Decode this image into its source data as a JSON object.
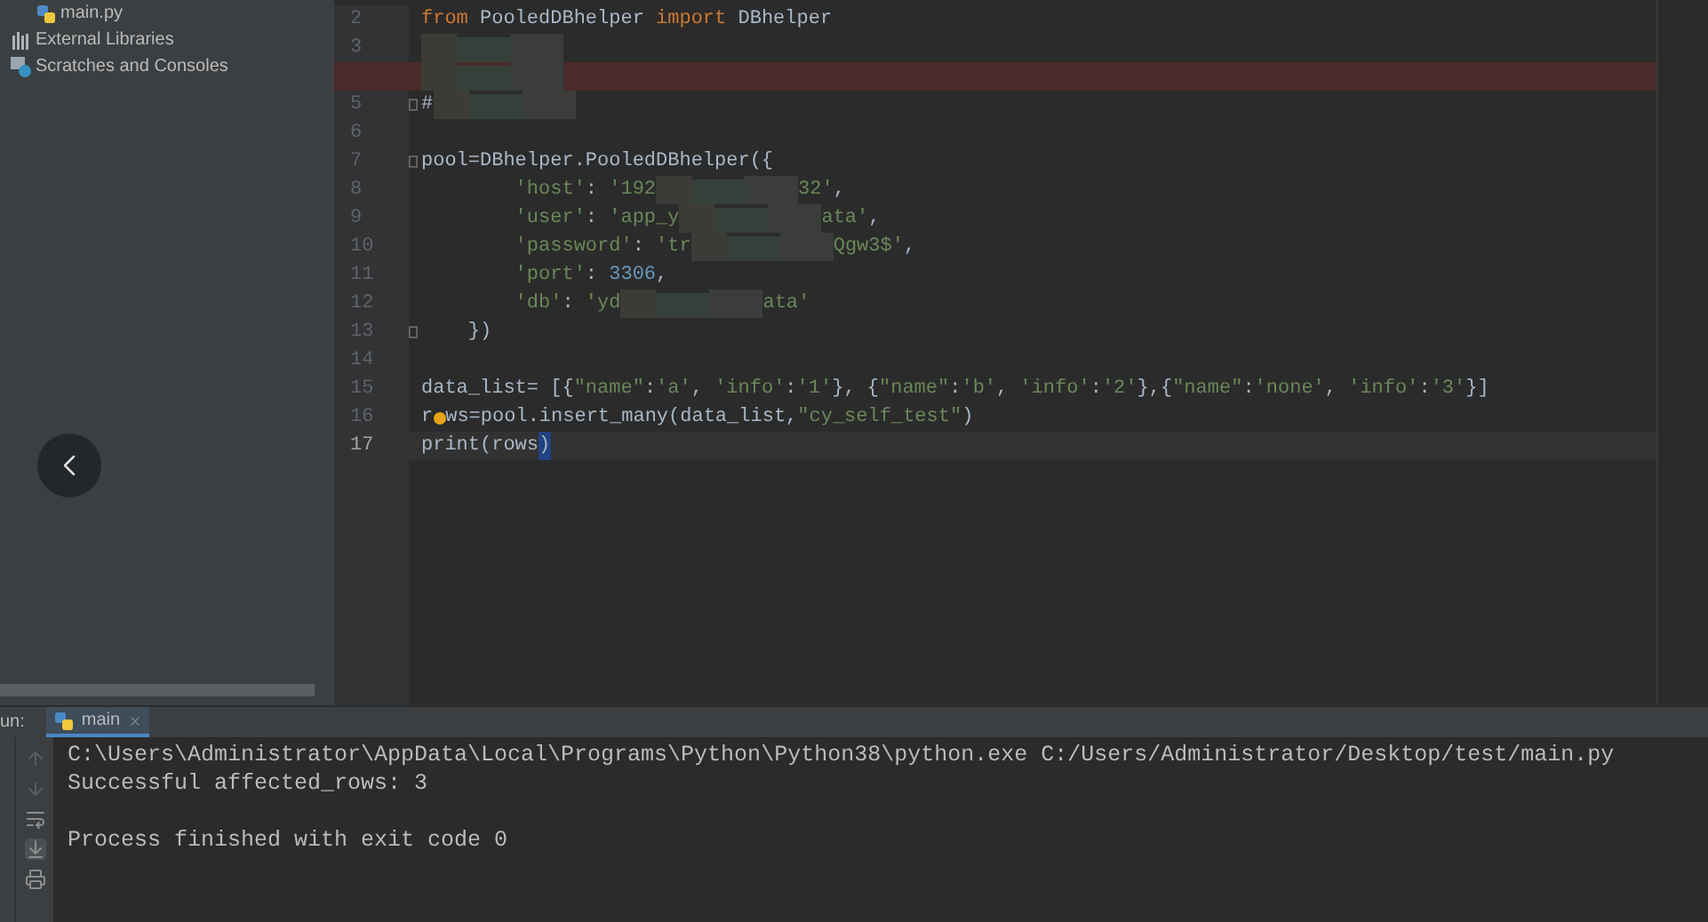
{
  "project_tree": [
    {
      "kind": "file",
      "label": "main.py"
    },
    {
      "kind": "library",
      "label": "External Libraries"
    },
    {
      "kind": "scratches",
      "label": "Scratches and Consoles"
    }
  ],
  "editor": {
    "lines": [
      {
        "number": "2",
        "tokens": [
          {
            "kind": "keyword",
            "text": "from"
          },
          {
            "kind": "plain",
            "text": " PooledDBhelper "
          },
          {
            "kind": "keyword",
            "text": "import"
          },
          {
            "kind": "plain",
            "text": " DBhelper"
          }
        ]
      },
      {
        "number": "3",
        "tokens": [
          {
            "kind": "redacted"
          }
        ]
      },
      {
        "error": true,
        "tokens": [
          {
            "kind": "redacted"
          }
        ]
      },
      {
        "number": "5",
        "fold": true,
        "tokens": [
          {
            "kind": "plain",
            "text": "#"
          },
          {
            "kind": "redacted"
          }
        ]
      },
      {
        "number": "6"
      },
      {
        "number": "7",
        "fold": true,
        "tokens": [
          {
            "kind": "plain",
            "text": "pool=DBhelper.PooledDBhelper({"
          }
        ]
      },
      {
        "number": "8",
        "tokens": [
          {
            "kind": "string",
            "text": "        'host'"
          },
          {
            "kind": "plain",
            "text": ": "
          },
          {
            "kind": "string",
            "text": "'192"
          },
          {
            "kind": "redacted"
          },
          {
            "kind": "string",
            "text": "32'"
          },
          {
            "kind": "plain",
            "text": ","
          }
        ]
      },
      {
        "number": "9",
        "tokens": [
          {
            "kind": "string",
            "text": "        'user'"
          },
          {
            "kind": "plain",
            "text": ": "
          },
          {
            "kind": "string",
            "text": "'app_y"
          },
          {
            "kind": "redacted"
          },
          {
            "kind": "string",
            "text": "ata'"
          },
          {
            "kind": "plain",
            "text": ","
          }
        ]
      },
      {
        "number": "10",
        "tokens": [
          {
            "kind": "string",
            "text": "        'password'"
          },
          {
            "kind": "plain",
            "text": ": "
          },
          {
            "kind": "string",
            "text": "'tr"
          },
          {
            "kind": "redacted"
          },
          {
            "kind": "string",
            "text": "Qgw3$'"
          },
          {
            "kind": "plain",
            "text": ","
          }
        ]
      },
      {
        "number": "11",
        "tokens": [
          {
            "kind": "string",
            "text": "        'port'"
          },
          {
            "kind": "plain",
            "text": ": "
          },
          {
            "kind": "number",
            "text": "3306"
          },
          {
            "kind": "plain",
            "text": ","
          }
        ]
      },
      {
        "number": "12",
        "tokens": [
          {
            "kind": "string",
            "text": "        'db'"
          },
          {
            "kind": "plain",
            "text": ": "
          },
          {
            "kind": "string",
            "text": "'yd"
          },
          {
            "kind": "redacted"
          },
          {
            "kind": "string",
            "text": "ata'"
          }
        ]
      },
      {
        "number": "13",
        "fold": true,
        "tokens": [
          {
            "kind": "plain",
            "text": "    })"
          }
        ]
      },
      {
        "number": "14"
      },
      {
        "number": "15",
        "tokens": [
          {
            "kind": "plain",
            "text": "data_list= [{"
          },
          {
            "kind": "string",
            "text": "\"name\""
          },
          {
            "kind": "plain",
            "text": ":"
          },
          {
            "kind": "string",
            "text": "'a'"
          },
          {
            "kind": "plain",
            "text": ", "
          },
          {
            "kind": "string",
            "text": "'info'"
          },
          {
            "kind": "plain",
            "text": ":"
          },
          {
            "kind": "string",
            "text": "'1'"
          },
          {
            "kind": "plain",
            "text": "}, {"
          },
          {
            "kind": "string",
            "text": "\"name\""
          },
          {
            "kind": "plain",
            "text": ":"
          },
          {
            "kind": "string",
            "text": "'b'"
          },
          {
            "kind": "plain",
            "text": ", "
          },
          {
            "kind": "string",
            "text": "'info'"
          },
          {
            "kind": "plain",
            "text": ":"
          },
          {
            "kind": "string",
            "text": "'2'"
          },
          {
            "kind": "plain",
            "text": "},{"
          },
          {
            "kind": "string",
            "text": "\"name\""
          },
          {
            "kind": "plain",
            "text": ":"
          },
          {
            "kind": "string",
            "text": "'none'"
          },
          {
            "kind": "plain",
            "text": ", "
          },
          {
            "kind": "string",
            "text": "'info'"
          },
          {
            "kind": "plain",
            "text": ":"
          },
          {
            "kind": "string",
            "text": "'3'"
          },
          {
            "kind": "plain",
            "text": "}]"
          }
        ]
      },
      {
        "number": "16",
        "tokens": [
          {
            "kind": "plain",
            "text": "r"
          },
          {
            "kind": "bulb"
          },
          {
            "kind": "plain",
            "text": "ws=pool.insert_many(data_list,"
          },
          {
            "kind": "string",
            "text": "\"cy_self_test\""
          },
          {
            "kind": "plain",
            "text": ")"
          }
        ]
      },
      {
        "number": "17",
        "current": true,
        "tokens": [
          {
            "kind": "plain",
            "text": "print(rows"
          },
          {
            "kind": "match",
            "text": ")"
          }
        ]
      }
    ]
  },
  "run_panel": {
    "label": "un:",
    "tabs": [
      {
        "label": "main",
        "selected": true
      }
    ],
    "output": [
      [
        "C:\\Users\\Administrator\\AppData\\Local\\Programs\\Python\\Python38\\python.exe C:/Users/Administrator/Desktop/test/main.py",
        "Successful affected_rows: 3"
      ],
      [
        "Process finished with exit code 0"
      ]
    ]
  }
}
